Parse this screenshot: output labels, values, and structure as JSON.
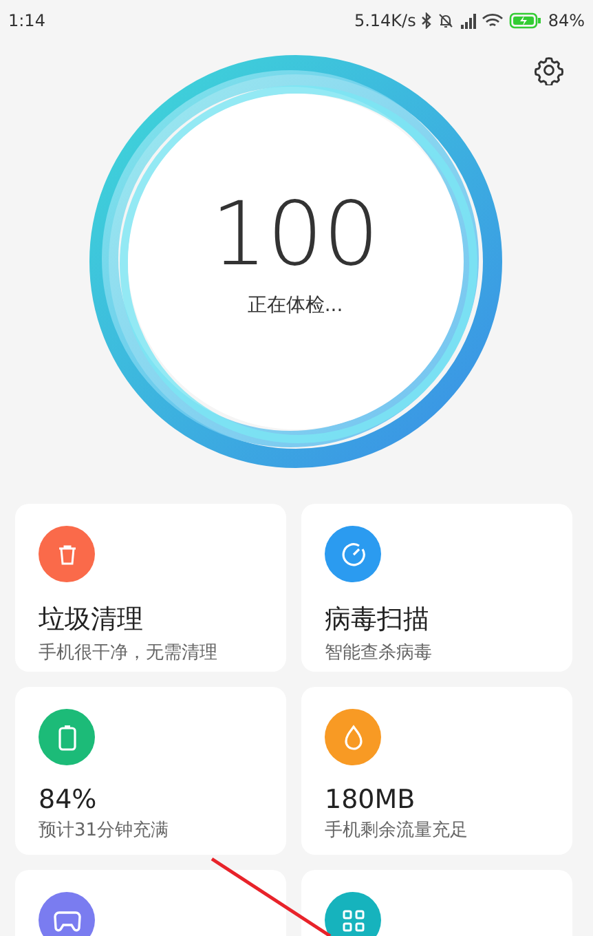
{
  "status_bar": {
    "time": "1:14",
    "speed": "5.14K/s",
    "battery": "84%"
  },
  "score": {
    "value": "100",
    "caption": "正在体检..."
  },
  "cards": [
    {
      "kind": "trash",
      "color": "#fa6a4a",
      "title": "垃圾清理",
      "subtitle": "手机很干净，无需清理"
    },
    {
      "kind": "gauge",
      "color": "#2b9bf0",
      "title": "病毒扫描",
      "subtitle": "智能查杀病毒"
    },
    {
      "kind": "battery",
      "color": "#1cbb78",
      "title": "84%",
      "subtitle": "预计31分钟充满"
    },
    {
      "kind": "drop",
      "color": "#f89a24",
      "title": "180MB",
      "subtitle": "手机剩余流量充足"
    },
    {
      "kind": "gamepad",
      "color": "#7a7cf0"
    },
    {
      "kind": "grid",
      "color": "#16b3bd"
    }
  ]
}
